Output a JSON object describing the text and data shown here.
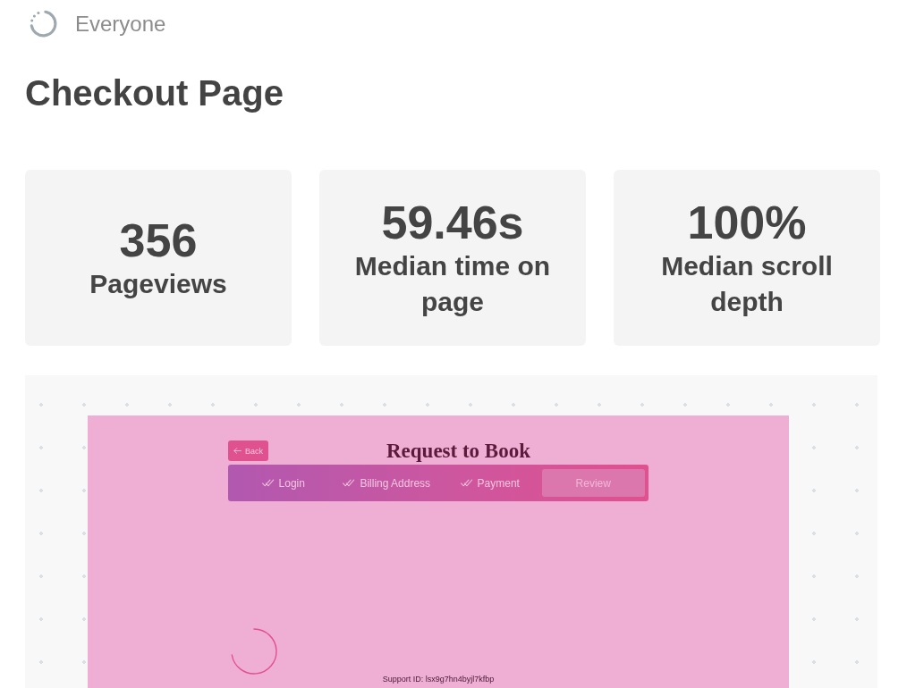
{
  "segment": {
    "label": "Everyone"
  },
  "title": "Checkout Page",
  "stats": [
    {
      "value": "356",
      "label": "Pageviews"
    },
    {
      "value": "59.46s",
      "label": "Median time on page"
    },
    {
      "value": "100%",
      "label": "Median scroll depth"
    }
  ],
  "preview": {
    "back_button": "Back",
    "heading": "Request to Book",
    "steps": [
      {
        "label": "Login",
        "done": true,
        "selected": false
      },
      {
        "label": "Billing Address",
        "done": true,
        "selected": false
      },
      {
        "label": "Payment",
        "done": true,
        "selected": false
      },
      {
        "label": "Review",
        "done": false,
        "selected": true
      }
    ],
    "support_id": "Support ID: lsx9g7hn4byjl7kfbp"
  }
}
